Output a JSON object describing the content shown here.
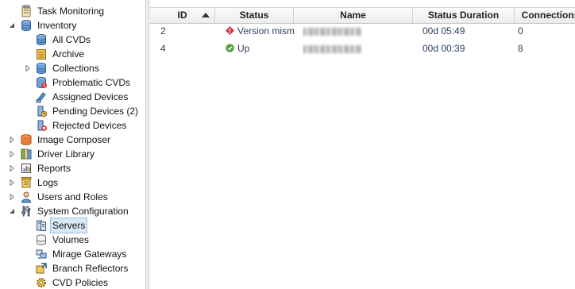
{
  "tree": {
    "items": [
      {
        "name": "task-monitoring",
        "label": "Task Monitoring",
        "icon": "clipboard-icon",
        "level": 1,
        "expander": "none"
      },
      {
        "name": "inventory",
        "label": "Inventory",
        "icon": "database-icon",
        "level": 1,
        "expander": "expanded"
      },
      {
        "name": "all-cvds",
        "label": "All CVDs",
        "icon": "database-icon",
        "level": 2,
        "expander": "none"
      },
      {
        "name": "archive",
        "label": "Archive",
        "icon": "archive-icon",
        "level": 2,
        "expander": "none"
      },
      {
        "name": "collections",
        "label": "Collections",
        "icon": "collections-icon",
        "level": 2,
        "expander": "collapsed"
      },
      {
        "name": "problematic-cvds",
        "label": "Problematic CVDs",
        "icon": "problem-database-icon",
        "level": 2,
        "expander": "none"
      },
      {
        "name": "assigned-devices",
        "label": "Assigned Devices",
        "icon": "assigned-device-icon",
        "level": 2,
        "expander": "none"
      },
      {
        "name": "pending-devices",
        "label": "Pending Devices (2)",
        "icon": "pending-device-icon",
        "level": 2,
        "expander": "none"
      },
      {
        "name": "rejected-devices",
        "label": "Rejected Devices",
        "icon": "rejected-device-icon",
        "level": 2,
        "expander": "none"
      },
      {
        "name": "image-composer",
        "label": "Image Composer",
        "icon": "image-composer-icon",
        "level": 1,
        "expander": "collapsed"
      },
      {
        "name": "driver-library",
        "label": "Driver Library",
        "icon": "driver-library-icon",
        "level": 1,
        "expander": "collapsed"
      },
      {
        "name": "reports",
        "label": "Reports",
        "icon": "reports-icon",
        "level": 1,
        "expander": "collapsed"
      },
      {
        "name": "logs",
        "label": "Logs",
        "icon": "logs-icon",
        "level": 1,
        "expander": "collapsed"
      },
      {
        "name": "users-and-roles",
        "label": "Users and Roles",
        "icon": "users-icon",
        "level": 1,
        "expander": "collapsed"
      },
      {
        "name": "system-configuration",
        "label": "System Configuration",
        "icon": "tools-icon",
        "level": 1,
        "expander": "expanded"
      },
      {
        "name": "servers",
        "label": "Servers",
        "icon": "servers-icon",
        "level": 2,
        "expander": "none",
        "selected": true
      },
      {
        "name": "volumes",
        "label": "Volumes",
        "icon": "volumes-icon",
        "level": 2,
        "expander": "none"
      },
      {
        "name": "mirage-gateways",
        "label": "Mirage Gateways",
        "icon": "gateway-icon",
        "level": 2,
        "expander": "none"
      },
      {
        "name": "branch-reflectors",
        "label": "Branch Reflectors",
        "icon": "branch-reflector-icon",
        "level": 2,
        "expander": "none"
      },
      {
        "name": "cvd-policies",
        "label": "CVD Policies",
        "icon": "gear-icon",
        "level": 2,
        "expander": "none"
      }
    ]
  },
  "grid": {
    "columns": [
      "ID",
      "Status",
      "Name",
      "Status Duration",
      "Connections"
    ],
    "sort": {
      "column": "ID",
      "direction": "ascending"
    },
    "rows": [
      {
        "id": "2",
        "status": "Version mism",
        "status_icon": "error-icon",
        "duration": "00d 05:49",
        "connections": "0"
      },
      {
        "id": "4",
        "status": "Up",
        "status_icon": "ok-icon",
        "duration": "00d 00:39",
        "connections": "8"
      }
    ]
  },
  "colors": {
    "selected_bg": "#d9e8f7",
    "header_bg": "#ececec",
    "error": "#d9363e",
    "ok": "#5aa33a",
    "text_link": "#2b3e5a"
  }
}
